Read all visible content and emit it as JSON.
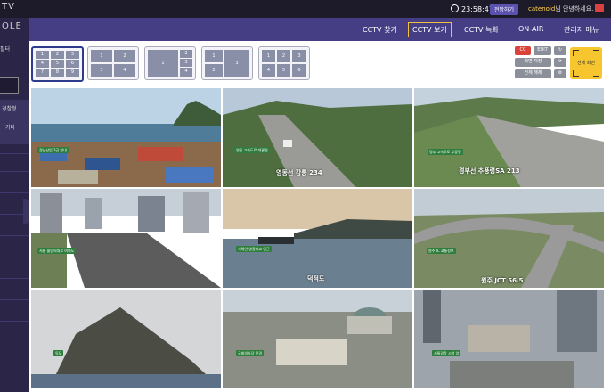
{
  "header": {
    "brand_line1": "TV",
    "brand_line2": "OLE",
    "clock": "23:58:47",
    "fullscreen_label": "전망하기",
    "welcome_user": "catenoid",
    "welcome_suffix": "님 안녕하세요."
  },
  "nav": {
    "items": [
      "CCTV 찾기",
      "CCTV 보기",
      "CCTV 녹화",
      "ON-AIR",
      "관리자 메뉴"
    ],
    "active_index": 1
  },
  "sidebar": {
    "item1": "필터",
    "item2": "경찰청",
    "item3": "기타"
  },
  "layouts": [
    {
      "cells": [
        "1",
        "2",
        "3",
        "4",
        "5",
        "6",
        "7",
        "8",
        "9"
      ]
    },
    {
      "cells": [
        "1",
        "2",
        "3",
        "4"
      ]
    },
    {
      "cells": [
        "1",
        "2",
        "3",
        "4"
      ]
    },
    {
      "cells": [
        "1",
        "2",
        "3"
      ]
    },
    {
      "cells": [
        "1",
        "2",
        "3",
        "4",
        "5",
        "6"
      ]
    }
  ],
  "controls": {
    "cc": "CC",
    "edit": "EDIT",
    "save": "화면 저장",
    "clear": "전체 해제",
    "full": "전체 화면"
  },
  "cameras": [
    {
      "badge": "경남산업 3곳 안내",
      "overlay": ""
    },
    {
      "badge": "영동 고속도로 대관령",
      "overlay": "영동선  강릉  234"
    },
    {
      "badge": "경부 고속도로 추풍령",
      "overlay": "경부선  추풍령SA  213"
    },
    {
      "badge": "서울 올림픽대로 여의도",
      "overlay": ""
    },
    {
      "badge": "서해안 영종대교 인근",
      "overlay": "덕적도"
    },
    {
      "badge": "원주 IC 교통정보",
      "overlay": "원주 JCT  56.5"
    },
    {
      "badge": "독도",
      "overlay": ""
    },
    {
      "badge": "국회의사당 전경",
      "overlay": ""
    },
    {
      "badge": "서울광장 시청 앞",
      "overlay": ""
    }
  ]
}
